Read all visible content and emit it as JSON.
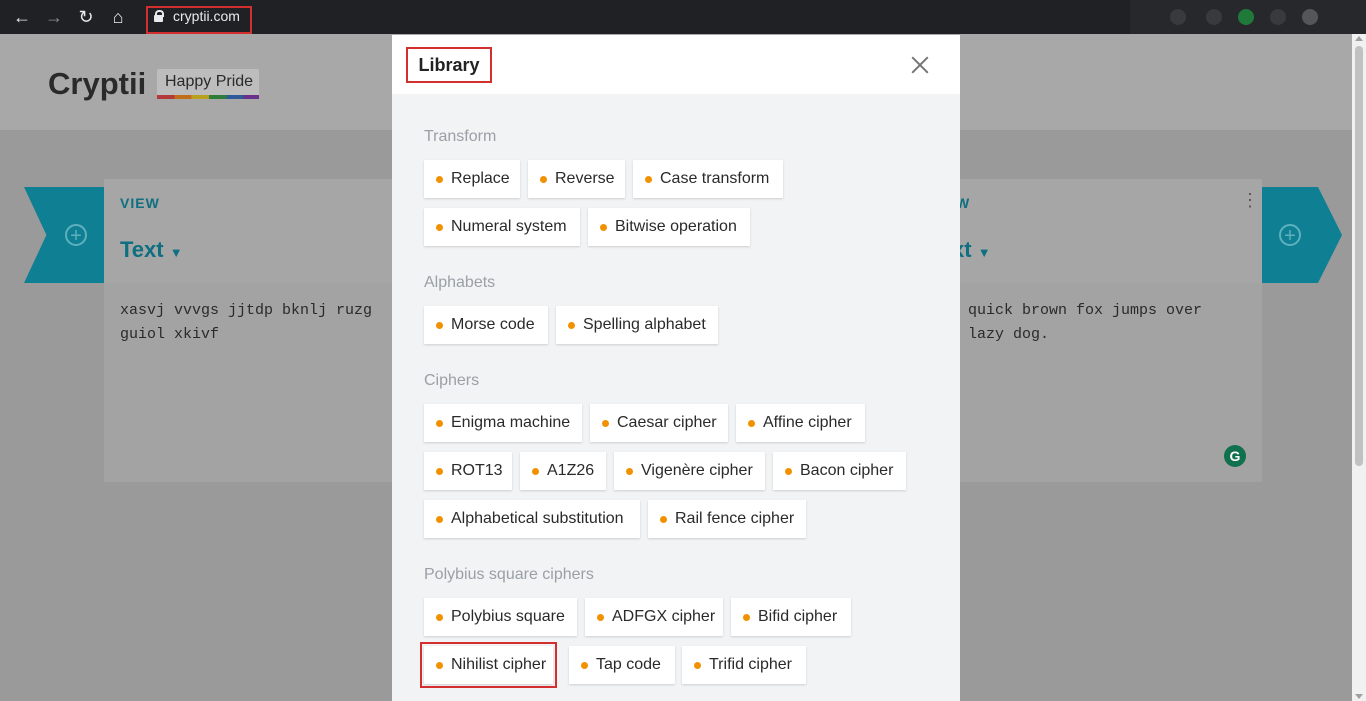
{
  "browser": {
    "url": "cryptii.com"
  },
  "page": {
    "brand": "Cryptii",
    "badge": "Happy Pride",
    "left_card": {
      "view_label": "VIEW",
      "view_type": "Text",
      "content": "xasvj vvvgs jjtdp bknlj ruzg\nguiol xkivf"
    },
    "right_card": {
      "view_label": "W",
      "view_type": "xt",
      "content": "quick brown fox jumps over\nlazy dog."
    }
  },
  "modal": {
    "title": "Library",
    "sections": [
      {
        "title": "Transform",
        "items": [
          "Replace",
          "Reverse",
          "Case transform",
          "Numeral system",
          "Bitwise operation"
        ]
      },
      {
        "title": "Alphabets",
        "items": [
          "Morse code",
          "Spelling alphabet"
        ]
      },
      {
        "title": "Ciphers",
        "items": [
          "Enigma machine",
          "Caesar cipher",
          "Affine cipher",
          "ROT13",
          "A1Z26",
          "Vigenère cipher",
          "Bacon cipher",
          "Alphabetical substitution",
          "Rail fence cipher"
        ]
      },
      {
        "title": "Polybius square ciphers",
        "items": [
          "Polybius square",
          "ADFGX cipher",
          "Bifid cipher",
          "Nihilist cipher",
          "Tap code",
          "Trifid cipher"
        ]
      }
    ]
  },
  "colors": {
    "accent_teal": "#0f7f93",
    "chip_dot": "#f29100",
    "highlight_red": "#d32f2f"
  }
}
